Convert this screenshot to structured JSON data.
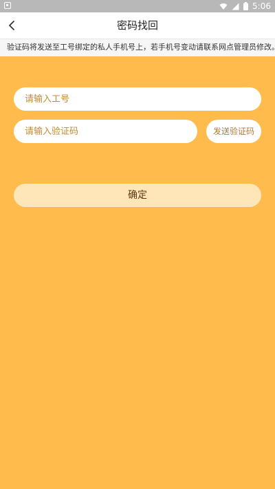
{
  "status_bar": {
    "time": "5:06",
    "icons": [
      "notification-icon",
      "wifi-icon",
      "signal-icon",
      "battery-icon"
    ]
  },
  "nav": {
    "title": "密码找回",
    "back_icon": "chevron-left-icon"
  },
  "notice": {
    "text": "验证码将发送至工号绑定的私人手机号上，若手机号变动请联系网点管理员修改。"
  },
  "form": {
    "employee_id": {
      "value": "",
      "placeholder": "请输入工号"
    },
    "verification_code": {
      "value": "",
      "placeholder": "请输入验证码"
    },
    "send_code_label": "发送验证码",
    "confirm_label": "确定"
  },
  "colors": {
    "background": "#FFBB4C",
    "status_bar": "#B8B8B8",
    "confirm_button": "#FFE6B8",
    "placeholder": "#C08A3A"
  }
}
